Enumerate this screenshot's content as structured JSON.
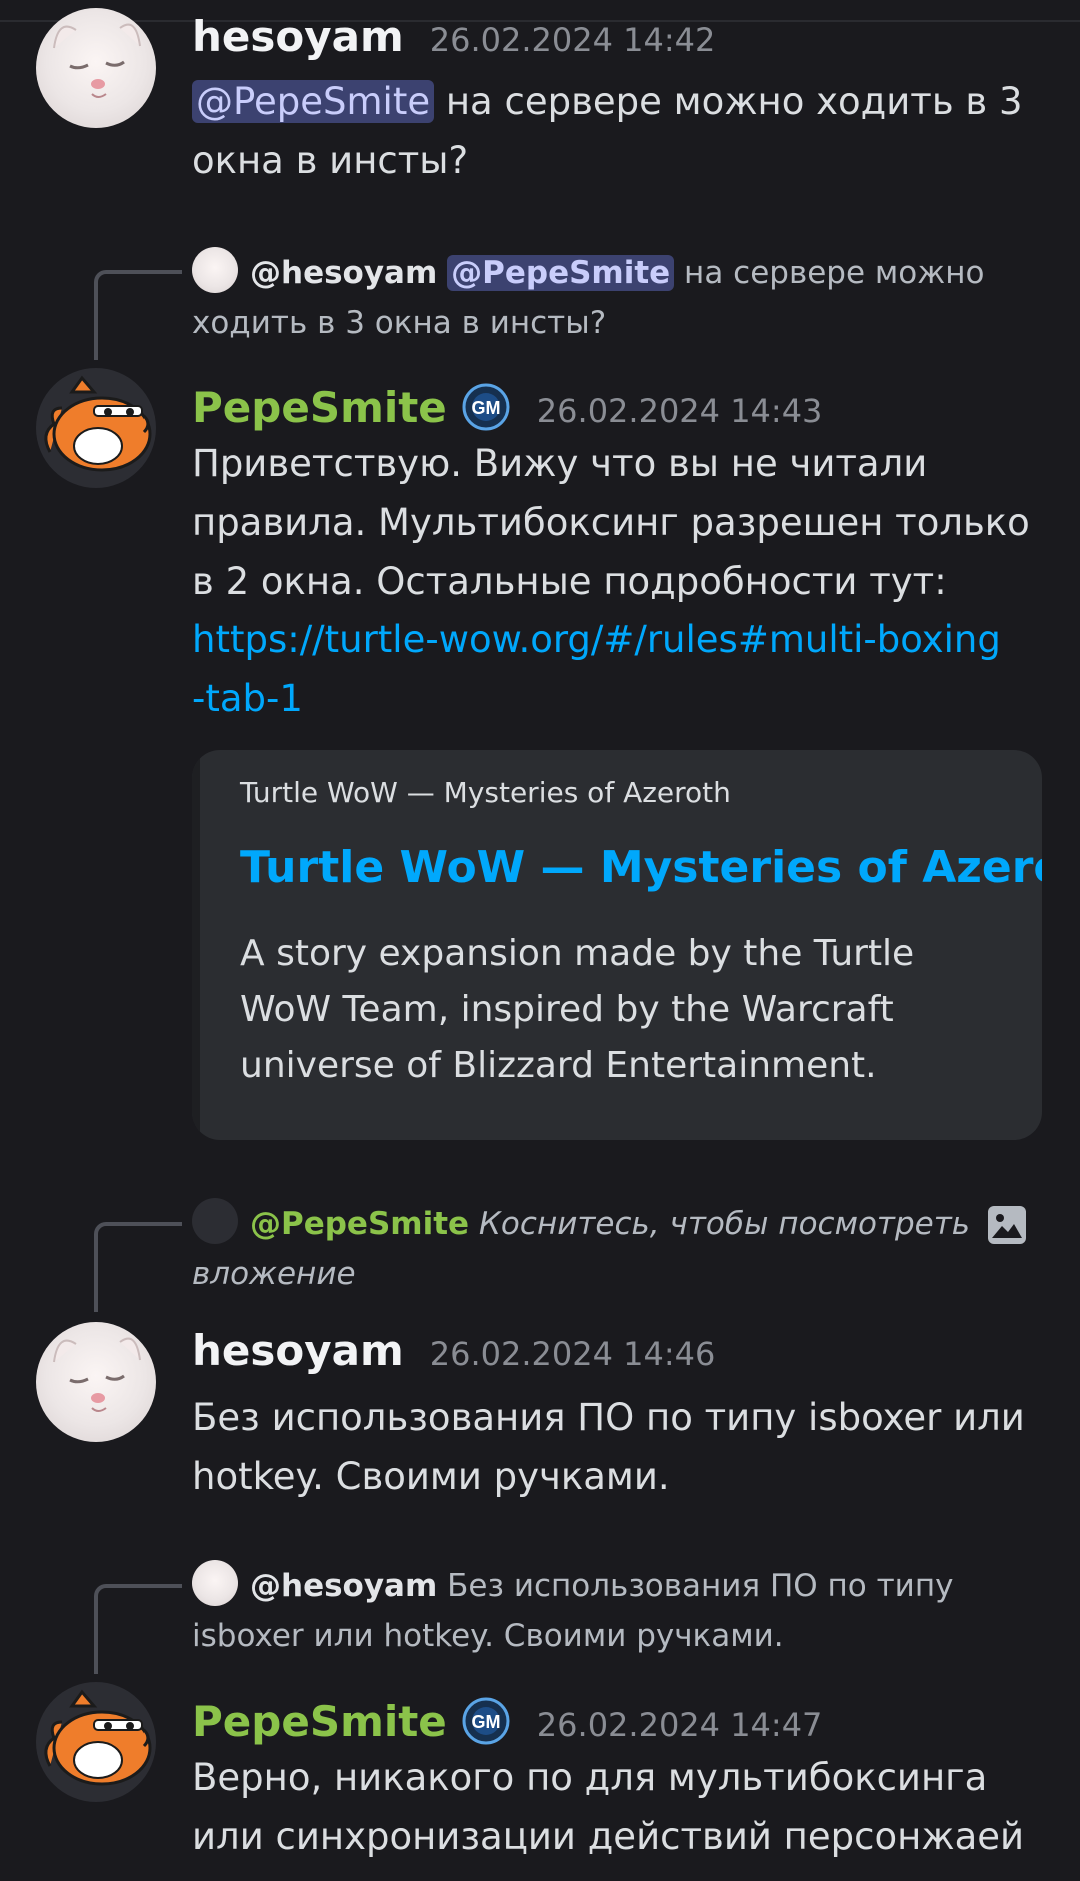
{
  "messages": [
    {
      "author": "hesoyam",
      "timestamp": "26.02.2024 14:42",
      "mention": "@PepeSmite",
      "text_after_mention": " на сервере можно ходить в 3 окна в инсты?"
    },
    {
      "reply": {
        "author": "@hesoyam",
        "mention": "@PepeSmite",
        "text": " на сервере можно ходить в 3 окна в инсты?"
      },
      "author": "PepeSmite",
      "badge": "GM",
      "timestamp": "26.02.2024 14:43",
      "text": "Приветствую. Вижу что вы не читали правила. Мультибоксинг разрешен только в 2 окна. Остальные подробности тут:",
      "link": "https://turtle-wow.org/#/rules#multi-boxing-tab-1",
      "link_line1": "https://turtle-wow.org/#/rules#multi-boxing",
      "link_line2": "-tab-1",
      "embed": {
        "provider": "Turtle WoW — Mysteries of Azeroth",
        "title": "Turtle WoW — Mysteries of Azeroth",
        "description": "A story expansion made by the Turtle WoW Team, inspired by the Warcraft universe of Blizzard Entertainment."
      }
    },
    {
      "reply": {
        "author": "@PepeSmite",
        "text": "Коснитесь, чтобы посмотреть вложение",
        "icon": "image-icon"
      },
      "author": "hesoyam",
      "timestamp": "26.02.2024 14:46",
      "text": "Без использования ПО по типу isboxer или hotkey. Своими ручками."
    },
    {
      "reply": {
        "author": "@hesoyam",
        "text": " Без использования ПО по типу isboxer или hotkey. Своими ручками."
      },
      "author": "PepeSmite",
      "badge": "GM",
      "timestamp": "26.02.2024 14:47",
      "text": "Верно, никакого по для мультибоксинга или синхронизации действий персонжаей"
    }
  ],
  "colors": {
    "background": "#1a1a1e",
    "pepe_name": "#8bc34a",
    "link": "#00a8fc",
    "mention_bg": "#3c4270"
  }
}
